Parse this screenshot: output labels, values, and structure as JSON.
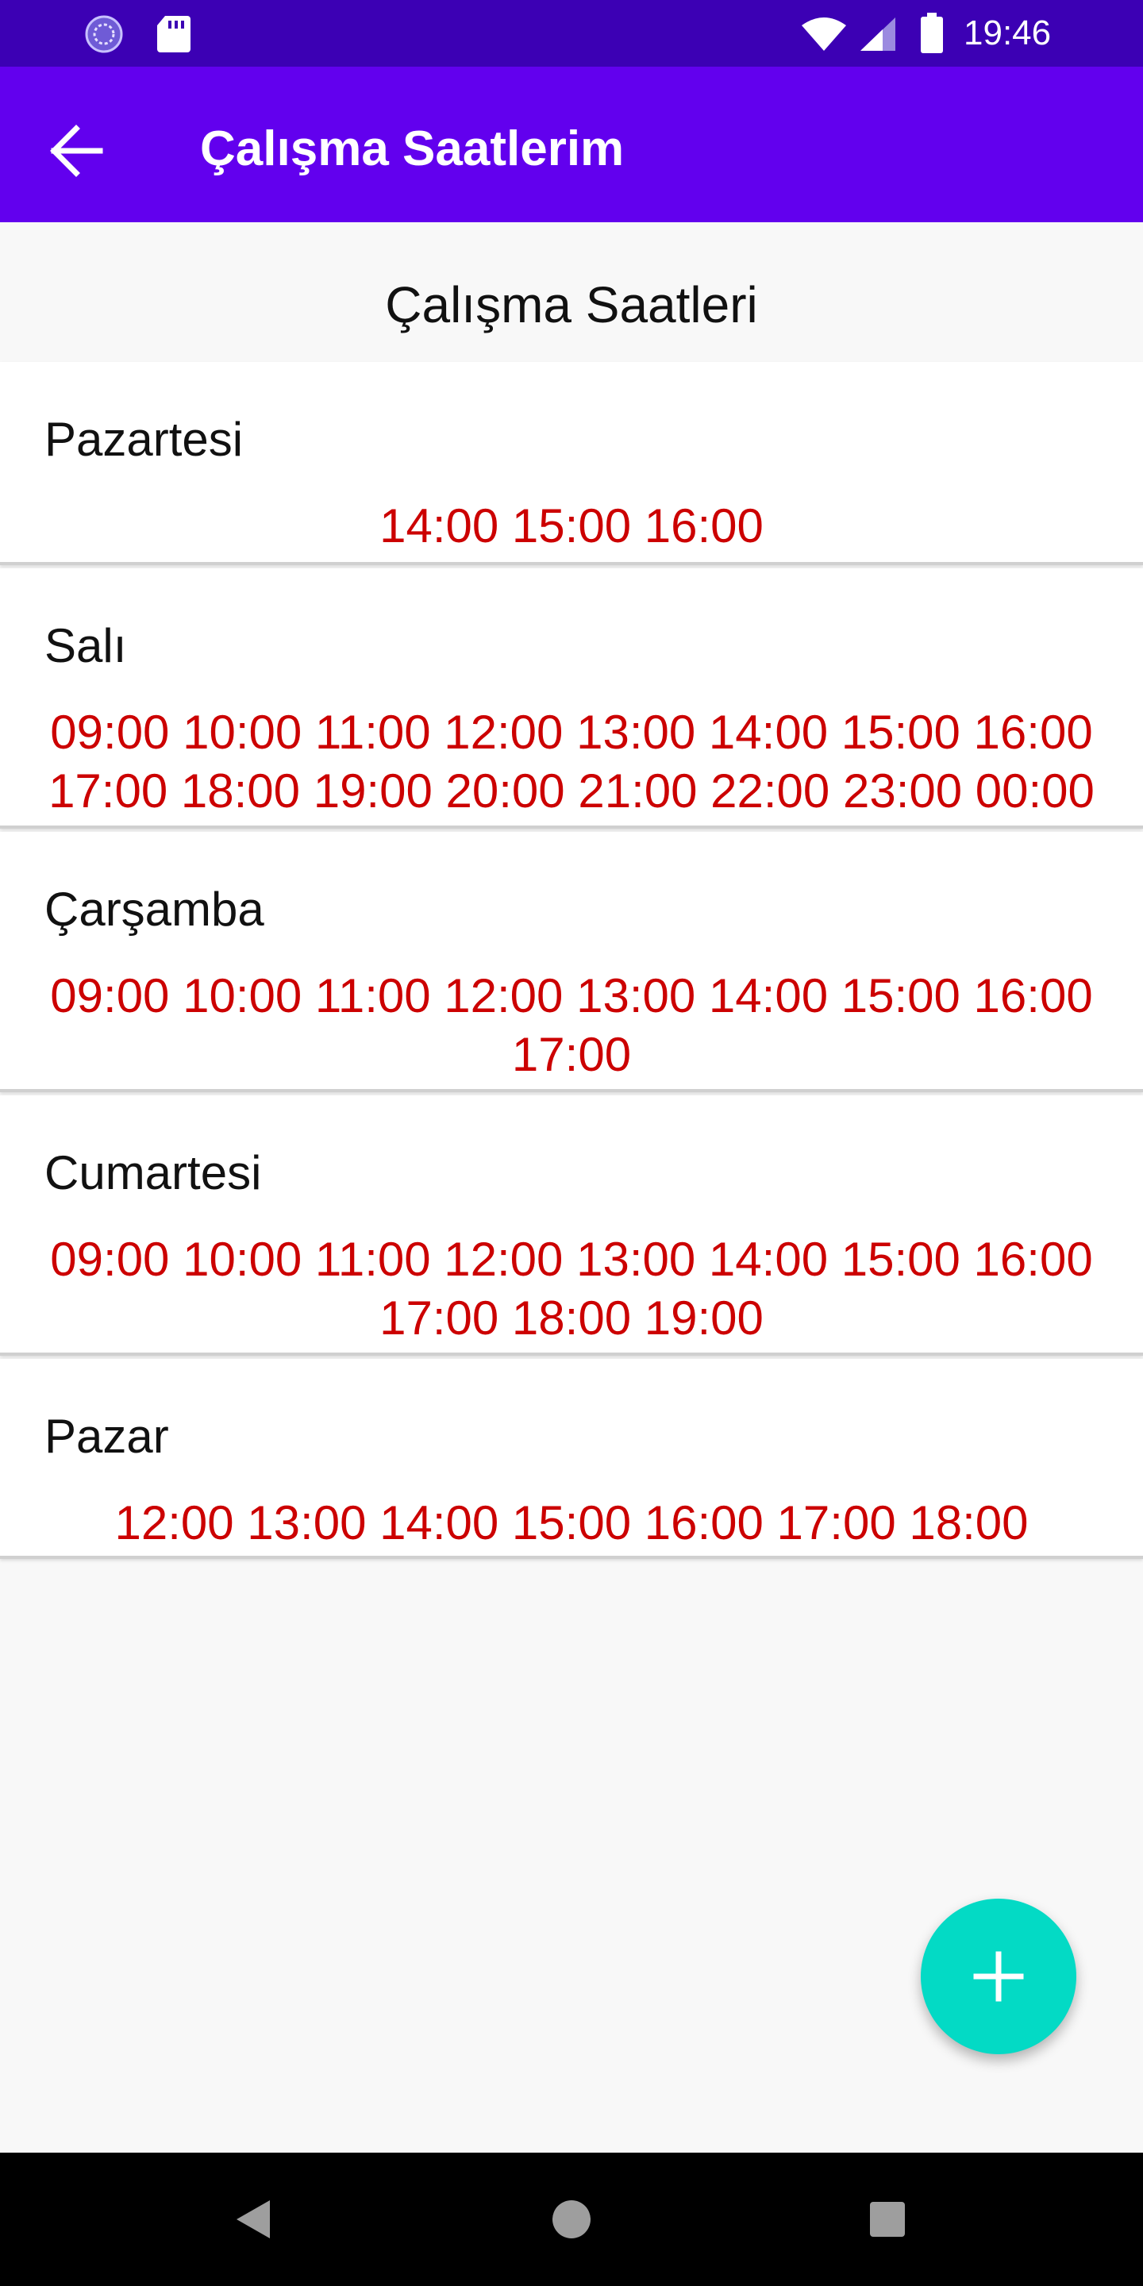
{
  "status_bar": {
    "time": "19:46",
    "icons": [
      "sync-icon",
      "sd-card-icon",
      "wifi-icon",
      "signal-icon",
      "battery-icon"
    ]
  },
  "app_bar": {
    "title": "Çalışma Saatlerim",
    "back_icon": "arrow-back-icon"
  },
  "section_title": "Çalışma Saatleri",
  "days": [
    {
      "day": "Pazartesi",
      "times": "14:00 15:00 16:00"
    },
    {
      "day": "Salı",
      "times": "09:00 10:00 11:00 12:00 13:00 14:00 15:00 16:00 17:00 18:00 19:00 20:00 21:00 22:00 23:00 00:00"
    },
    {
      "day": "Çarşamba",
      "times": "09:00 10:00 11:00 12:00 13:00 14:00 15:00 16:00 17:00"
    },
    {
      "day": "Cumartesi",
      "times": "09:00 10:00 11:00 12:00 13:00 14:00 15:00 16:00 17:00 18:00 19:00"
    },
    {
      "day": "Pazar",
      "times": "12:00 13:00 14:00 15:00 16:00 17:00 18:00"
    }
  ],
  "fab": {
    "icon": "plus-icon"
  },
  "nav_bar": {
    "icons": [
      "nav-back-icon",
      "nav-home-icon",
      "nav-recents-icon"
    ]
  },
  "colors": {
    "status_bar": "#3c00b4",
    "app_bar": "#6200ee",
    "time_text": "#cc0000",
    "fab": "#03dac5",
    "background": "#f8f8f8"
  }
}
